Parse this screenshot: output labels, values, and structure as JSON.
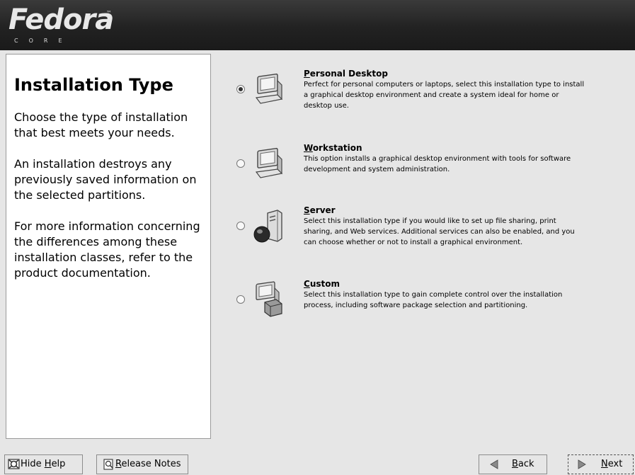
{
  "header": {
    "logo_text": "Fedora",
    "logo_tm": "™",
    "logo_sub": "CORE"
  },
  "help": {
    "title": "Installation Type",
    "paragraphs": [
      "Choose the type of installation that best meets your needs.",
      "An installation destroys any previously saved information on the selected partitions.",
      "For more information concerning the differences among these installation classes, refer to the product documentation."
    ]
  },
  "options": [
    {
      "mnemonic": "P",
      "rest": "ersonal Desktop",
      "description": "Perfect for personal computers or laptops, select this installation type to install a graphical desktop environment and create a system ideal for home or desktop use.",
      "selected": true,
      "icon": "desktop-computer-icon"
    },
    {
      "mnemonic": "W",
      "rest": "orkstation",
      "description": "This option installs a graphical desktop environment with tools for software development and system administration.",
      "selected": false,
      "icon": "workstation-computer-icon"
    },
    {
      "mnemonic": "S",
      "rest": "erver",
      "description": "Select this installation type if you would like to set up file sharing, print sharing, and Web services. Additional services can also be enabled, and you can choose whether or not to install a graphical environment.",
      "selected": false,
      "icon": "server-globe-icon"
    },
    {
      "mnemonic": "C",
      "rest": "ustom",
      "description": "Select this installation type to gain complete control over the installation process, including software package selection and partitioning.",
      "selected": false,
      "icon": "custom-computer-box-icon"
    }
  ],
  "buttons": {
    "hide_help": {
      "pre": "Hide ",
      "mnemonic": "H",
      "post": "elp",
      "icon": "help-icon"
    },
    "release_notes": {
      "pre": "",
      "mnemonic": "R",
      "post": "elease Notes",
      "icon": "release-notes-icon"
    },
    "back": {
      "pre": "",
      "mnemonic": "B",
      "post": "ack",
      "icon": "back-arrow-icon"
    },
    "next": {
      "pre": "",
      "mnemonic": "N",
      "post": "ext",
      "icon": "next-arrow-icon"
    }
  }
}
